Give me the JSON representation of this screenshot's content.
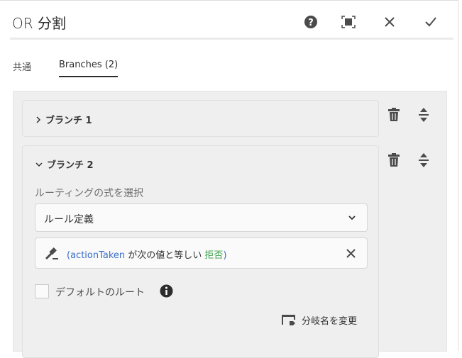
{
  "dialog": {
    "title": "OR 分割",
    "help_label": "help",
    "fullscreen_label": "fullscreen",
    "close_label": "close",
    "done_label": "done"
  },
  "tabs": [
    {
      "label": "共通"
    },
    {
      "label": "Branches (2)"
    }
  ],
  "branches": [
    {
      "name": "ブランチ 1",
      "expanded": false
    },
    {
      "name": "ブランチ 2",
      "expanded": true,
      "routing_label": "ルーティングの式を選択",
      "routing_value": "ルール定義",
      "condition": {
        "open": "(",
        "field": "actionTaken",
        "op": " が次の値と等しい ",
        "value": "拒否",
        "close": ")"
      },
      "default_route_label": "デフォルトのルート",
      "default_route_checked": false,
      "rename_label": "分岐名を変更"
    }
  ],
  "colors": {
    "field": "#3a6fc8",
    "value": "#3fa34d"
  }
}
